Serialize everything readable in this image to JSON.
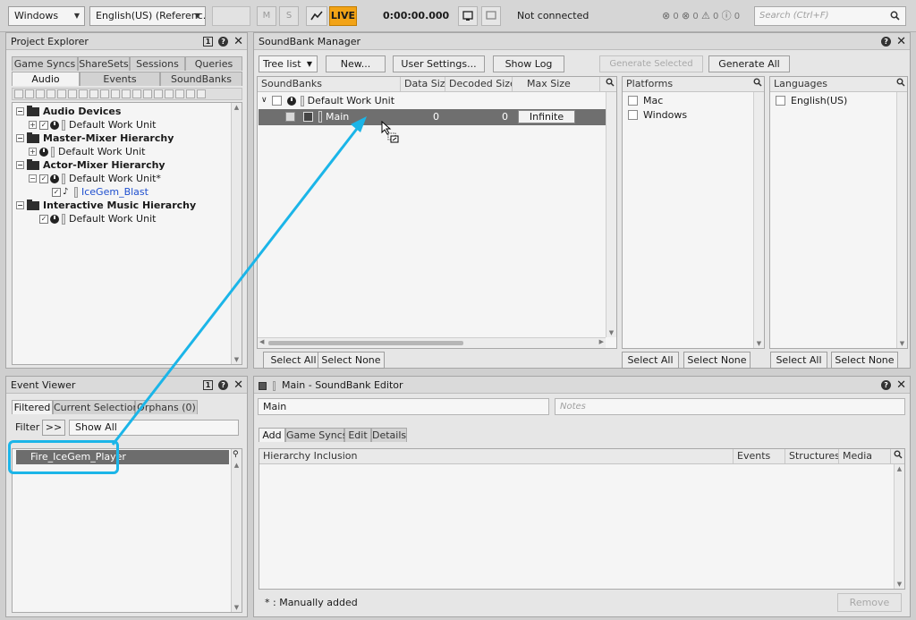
{
  "toolbar": {
    "platform": "Windows",
    "language": "English(US) (Referenc...",
    "mute_label": "M",
    "solo_label": "S",
    "live_label": "LIVE",
    "time": "0:00:00.000",
    "connection": "Not connected",
    "errors": "0",
    "errors2": "0",
    "warnings": "0",
    "messages": "0",
    "search_placeholder": "Search (Ctrl+F)"
  },
  "project_explorer": {
    "title": "Project Explorer",
    "tabs_top": [
      "Game Syncs",
      "ShareSets",
      "Sessions",
      "Queries"
    ],
    "tabs_bottom": [
      "Audio",
      "Events",
      "SoundBanks"
    ],
    "tree": [
      {
        "label": "Audio Devices",
        "bold": true
      },
      {
        "label": "Default Work Unit",
        "bold": false
      },
      {
        "label": "Master-Mixer Hierarchy",
        "bold": true
      },
      {
        "label": "Default Work Unit",
        "bold": false
      },
      {
        "label": "Actor-Mixer Hierarchy",
        "bold": true
      },
      {
        "label": "Default Work Unit*",
        "bold": false
      },
      {
        "label": "IceGem_Blast",
        "bold": false
      },
      {
        "label": "Interactive Music Hierarchy",
        "bold": true
      },
      {
        "label": "Default Work Unit",
        "bold": false
      }
    ]
  },
  "event_viewer": {
    "title": "Event Viewer",
    "tabs": [
      "Filtered",
      "Current Selection",
      "Orphans (0)"
    ],
    "filter_label": "Filter",
    "filter_btn": ">>",
    "filter_value": "Show All",
    "selected_event": "Fire_IceGem_Player"
  },
  "soundbank_manager": {
    "title": "SoundBank Manager",
    "view_mode": "Tree list",
    "new_btn": "New...",
    "user_settings_btn": "User Settings...",
    "show_log_btn": "Show Log",
    "generate_selected_btn": "Generate Selected",
    "generate_all_btn": "Generate All",
    "columns": [
      "SoundBanks",
      "Data Size",
      "Decoded Size",
      "Max Size"
    ],
    "work_unit": "Default Work Unit",
    "bank": {
      "name": "Main",
      "data_size": "0",
      "decoded_size": "0",
      "max_size": "Infinite"
    },
    "select_all": "Select All",
    "select_none": "Select None",
    "platforms_title": "Platforms",
    "platforms": [
      "Mac",
      "Windows"
    ],
    "languages_title": "Languages",
    "languages": [
      "English(US)"
    ]
  },
  "soundbank_editor": {
    "title": "Main - SoundBank Editor",
    "name": "Main",
    "notes_placeholder": "Notes",
    "tabs": [
      "Add",
      "Game Syncs",
      "Edit",
      "Details"
    ],
    "columns": [
      "Hierarchy Inclusion",
      "Events",
      "Structures",
      "Media"
    ],
    "footer_note": "* : Manually added",
    "remove_btn": "Remove"
  }
}
